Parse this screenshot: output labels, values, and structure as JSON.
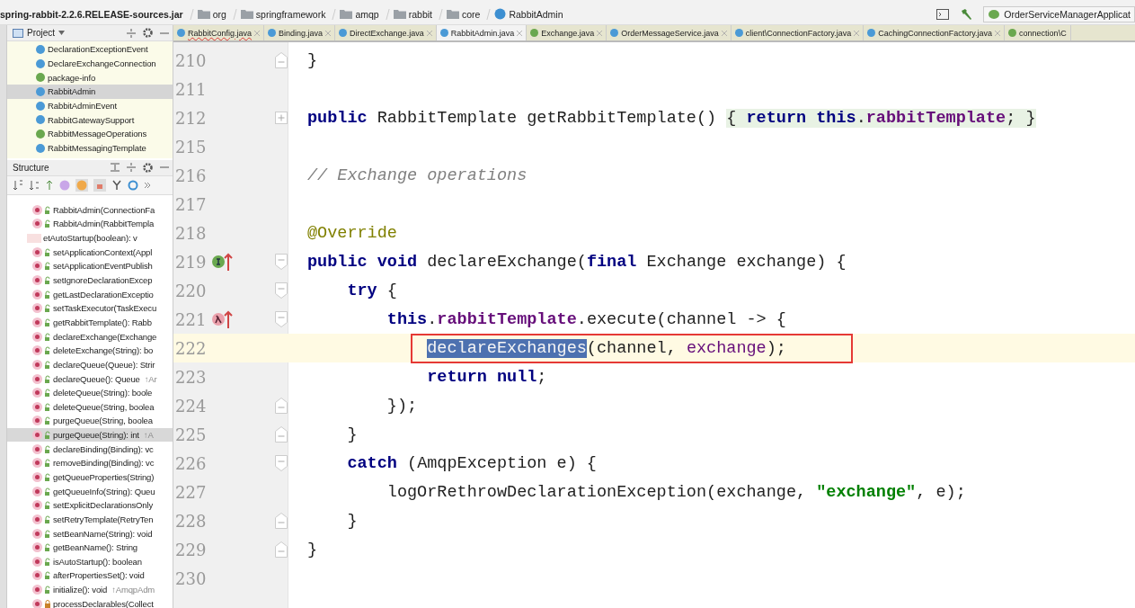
{
  "breadcrumb": [
    {
      "label": "spring-rabbit-2.2.6.RELEASE-sources.jar",
      "kind": "jar"
    },
    {
      "label": "org",
      "kind": "folder"
    },
    {
      "label": "springframework",
      "kind": "folder"
    },
    {
      "label": "amqp",
      "kind": "folder"
    },
    {
      "label": "rabbit",
      "kind": "folder"
    },
    {
      "label": "core",
      "kind": "folder"
    },
    {
      "label": "RabbitAdmin",
      "kind": "class"
    }
  ],
  "run_config": "OrderServiceManagerApplicat",
  "project_panel": {
    "title": "Project",
    "items": [
      {
        "label": "DeclarationExceptionEvent",
        "kind": "class",
        "selected": false
      },
      {
        "label": "DeclareExchangeConnection",
        "kind": "class",
        "selected": false
      },
      {
        "label": "package-info",
        "kind": "interface",
        "selected": false
      },
      {
        "label": "RabbitAdmin",
        "kind": "class",
        "selected": true
      },
      {
        "label": "RabbitAdminEvent",
        "kind": "class",
        "selected": false
      },
      {
        "label": "RabbitGatewaySupport",
        "kind": "class",
        "selected": false
      },
      {
        "label": "RabbitMessageOperations",
        "kind": "interface",
        "selected": false
      },
      {
        "label": "RabbitMessagingTemplate",
        "kind": "class",
        "selected": false
      }
    ]
  },
  "structure_panel": {
    "title": "Structure",
    "items": [
      {
        "label": "RabbitAdmin(ConnectionFa",
        "kind": "public",
        "selected": false
      },
      {
        "label": "RabbitAdmin(RabbitTempla",
        "kind": "public",
        "selected": false
      },
      {
        "label": "etAutoStartup(boolean): v",
        "kind": "obscured",
        "selected": false
      },
      {
        "label": "setApplicationContext(Appl",
        "kind": "public",
        "selected": false
      },
      {
        "label": "setApplicationEventPublish",
        "kind": "public",
        "selected": false
      },
      {
        "label": "setIgnoreDeclarationExcep",
        "kind": "public",
        "selected": false
      },
      {
        "label": "getLastDeclarationExceptio",
        "kind": "public",
        "selected": false
      },
      {
        "label": "setTaskExecutor(TaskExecu",
        "kind": "public",
        "selected": false
      },
      {
        "label": "getRabbitTemplate(): Rabb",
        "kind": "public",
        "selected": false
      },
      {
        "label": "declareExchange(Exchange",
        "kind": "public",
        "selected": false
      },
      {
        "label": "deleteExchange(String): bo",
        "kind": "public",
        "selected": false
      },
      {
        "label": "declareQueue(Queue): Strir",
        "kind": "public",
        "selected": false
      },
      {
        "label": "declareQueue(): Queue",
        "suffix": "↑Ar",
        "kind": "public",
        "selected": false
      },
      {
        "label": "deleteQueue(String): boole",
        "kind": "public",
        "selected": false
      },
      {
        "label": "deleteQueue(String, boolea",
        "kind": "public",
        "selected": false
      },
      {
        "label": "purgeQueue(String, boolea",
        "kind": "public",
        "selected": false
      },
      {
        "label": "purgeQueue(String): int",
        "suffix": "↑A",
        "kind": "public",
        "selected": true
      },
      {
        "label": "declareBinding(Binding): vc",
        "kind": "public",
        "selected": false
      },
      {
        "label": "removeBinding(Binding): vc",
        "kind": "public",
        "selected": false
      },
      {
        "label": "getQueueProperties(String)",
        "kind": "public",
        "selected": false
      },
      {
        "label": "getQueueInfo(String): Queu",
        "kind": "public",
        "selected": false
      },
      {
        "label": "setExplicitDeclarationsOnly",
        "kind": "public",
        "selected": false
      },
      {
        "label": "setRetryTemplate(RetryTen",
        "kind": "public",
        "selected": false
      },
      {
        "label": "setBeanName(String): void",
        "kind": "public",
        "selected": false
      },
      {
        "label": "getBeanName(): String",
        "kind": "public",
        "selected": false
      },
      {
        "label": "isAutoStartup(): boolean",
        "kind": "public",
        "selected": false
      },
      {
        "label": "afterPropertiesSet(): void",
        "kind": "public",
        "selected": false
      },
      {
        "label": "initialize(): void",
        "suffix": "↑AmqpAdm",
        "kind": "public",
        "selected": false
      },
      {
        "label": "processDeclarables(Collect",
        "kind": "private",
        "selected": false
      }
    ]
  },
  "tabs": [
    {
      "label": "RabbitConfig.java",
      "kind": "class",
      "error": true,
      "selected": false
    },
    {
      "label": "Binding.java",
      "kind": "class",
      "error": false,
      "selected": false
    },
    {
      "label": "DirectExchange.java",
      "kind": "class",
      "error": false,
      "selected": false
    },
    {
      "label": "RabbitAdmin.java",
      "kind": "class",
      "error": false,
      "selected": true
    },
    {
      "label": "Exchange.java",
      "kind": "interface",
      "error": false,
      "selected": false
    },
    {
      "label": "OrderMessageService.java",
      "kind": "class",
      "error": false,
      "selected": false
    },
    {
      "label": "client\\ConnectionFactory.java",
      "kind": "class",
      "error": false,
      "selected": false
    },
    {
      "label": "CachingConnectionFactory.java",
      "kind": "class",
      "error": false,
      "selected": false
    },
    {
      "label": "connection\\C",
      "kind": "interface",
      "error": false,
      "selected": false
    }
  ],
  "editor": {
    "lines": [
      {
        "number": "210",
        "fold_marker": {
          "kind": "end"
        },
        "current": false,
        "boxed": false,
        "segments": [
          {
            "t": "}",
            "kind": "plain"
          }
        ]
      },
      {
        "number": "211",
        "current": false,
        "boxed": false
      },
      {
        "number": "212",
        "fold_marker": {
          "kind": "plus"
        },
        "current": false,
        "boxed": false,
        "segments": [
          {
            "t": "public ",
            "kind": "kw"
          },
          {
            "t": "RabbitTemplate getRabbitTemplate() ",
            "kind": "plain"
          },
          {
            "t": "{ ",
            "kind": "folded"
          },
          {
            "t": "return this",
            "kind": "kwf"
          },
          {
            "t": ".",
            "kind": "folded"
          },
          {
            "t": "rabbitTemplate",
            "kind": "fieldf"
          },
          {
            "t": "; }",
            "kind": "folded"
          }
        ]
      },
      {
        "number": "215",
        "current": false,
        "boxed": false
      },
      {
        "number": "216",
        "current": false,
        "boxed": false,
        "segments": [
          {
            "t": "// Exchange operations",
            "kind": "comment"
          }
        ]
      },
      {
        "number": "217",
        "current": false,
        "boxed": false
      },
      {
        "number": "218",
        "current": false,
        "boxed": false,
        "segments": [
          {
            "t": "@Override",
            "kind": "annotation"
          }
        ]
      },
      {
        "number": "219",
        "fold_marker": {
          "kind": "start"
        },
        "gutter_icon": {
          "kind": "implements"
        },
        "current": false,
        "boxed": false,
        "segments": [
          {
            "t": "public void ",
            "kind": "kw"
          },
          {
            "t": "declareExchange(",
            "kind": "plain"
          },
          {
            "t": "final ",
            "kind": "kw"
          },
          {
            "t": "Exchange exchange) {",
            "kind": "plain"
          }
        ]
      },
      {
        "number": "220",
        "fold_marker": {
          "kind": "start"
        },
        "current": false,
        "boxed": false,
        "segments": [
          {
            "t": "    try ",
            "kind": "kw"
          },
          {
            "t": "{",
            "kind": "plain"
          }
        ]
      },
      {
        "number": "221",
        "fold_marker": {
          "kind": "start"
        },
        "gutter_icon": {
          "kind": "lambda"
        },
        "current": false,
        "boxed": false,
        "segments": [
          {
            "t": "        this",
            "kind": "kw"
          },
          {
            "t": ".",
            "kind": "plain"
          },
          {
            "t": "rabbitTemplate",
            "kind": "field"
          },
          {
            "t": ".execute(channel -> {",
            "kind": "plain"
          }
        ]
      },
      {
        "number": "222",
        "current": true,
        "boxed": true,
        "segments": [
          {
            "t": "declareExchanges",
            "kind": "selected"
          },
          {
            "t": "(channel, ",
            "kind": "plain"
          },
          {
            "t": "exchange",
            "kind": "captured"
          },
          {
            "t": ");",
            "kind": "plain"
          }
        ]
      },
      {
        "number": "223",
        "current": false,
        "boxed": false,
        "segments": [
          {
            "t": "            return null",
            "kind": "kw"
          },
          {
            "t": ";",
            "kind": "plain"
          }
        ]
      },
      {
        "number": "224",
        "fold_marker": {
          "kind": "end"
        },
        "current": false,
        "boxed": false,
        "segments": [
          {
            "t": "        });",
            "kind": "plain"
          }
        ]
      },
      {
        "number": "225",
        "fold_marker": {
          "kind": "end"
        },
        "current": false,
        "boxed": false,
        "segments": [
          {
            "t": "    }",
            "kind": "plain"
          }
        ]
      },
      {
        "number": "226",
        "fold_marker": {
          "kind": "start"
        },
        "current": false,
        "boxed": false,
        "segments": [
          {
            "t": "    catch ",
            "kind": "kw"
          },
          {
            "t": "(AmqpException e) {",
            "kind": "plain"
          }
        ]
      },
      {
        "number": "227",
        "current": false,
        "boxed": false,
        "segments": [
          {
            "t": "        logOrRethrowDeclarationException(exchange, ",
            "kind": "plain"
          },
          {
            "t": "\"exchange\"",
            "kind": "string"
          },
          {
            "t": ", e);",
            "kind": "plain"
          }
        ]
      },
      {
        "number": "228",
        "fold_marker": {
          "kind": "end"
        },
        "current": false,
        "boxed": false,
        "segments": [
          {
            "t": "    }",
            "kind": "plain"
          }
        ]
      },
      {
        "number": "229",
        "fold_marker": {
          "kind": "end"
        },
        "current": false,
        "boxed": false,
        "segments": [
          {
            "t": "}",
            "kind": "plain"
          }
        ]
      },
      {
        "number": "230",
        "current": false,
        "boxed": false
      }
    ]
  }
}
